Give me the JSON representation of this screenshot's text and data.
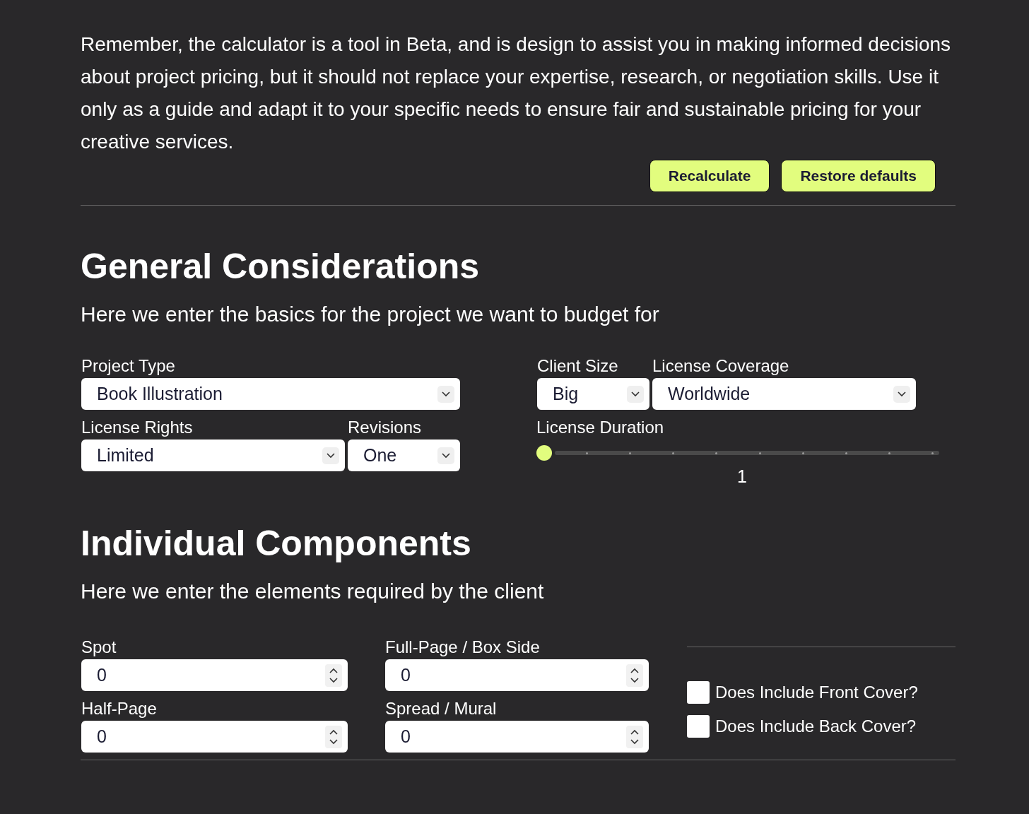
{
  "intro": {
    "text": "Remember, the calculator is a tool in Beta, and is design to assist you in making informed decisions about project pricing, but it should not replace your expertise, research, or negotiation skills. Use it only as a guide and adapt it to your specific needs to ensure fair and sustainable pricing for your creative services.",
    "buttons": [
      "Recalculate",
      "Restore defaults"
    ]
  },
  "general": {
    "title": "General Considerations",
    "subtitle": "Here we enter the basics for the project we want to budget for",
    "fields": [
      {
        "kind": "select",
        "label": "Project Type",
        "value": "Book Illustration"
      },
      {
        "kind": "select",
        "label": "Client Size",
        "value": "Big"
      },
      {
        "kind": "select",
        "label": "License Coverage",
        "value": "Worldwide"
      },
      {
        "kind": "select",
        "label": "License Rights",
        "value": "Limited"
      },
      {
        "kind": "select",
        "label": "Revisions",
        "value": "One"
      },
      {
        "kind": "slider",
        "label": "License Duration",
        "level": 0,
        "reading": "1"
      }
    ]
  },
  "components": {
    "title": "Individual Components",
    "subtitle": "Here we enter the elements required by the client",
    "fields": [
      {
        "kind": "number",
        "label": "Spot",
        "value": "0"
      },
      {
        "kind": "number",
        "label": "Full-Page / Box Side",
        "value": "0"
      },
      {
        "kind": "number",
        "label": "Half-Page",
        "value": "0"
      },
      {
        "kind": "number",
        "label": "Spread / Mural",
        "value": "0"
      }
    ],
    "checks": [
      {
        "label": "Does Include Front Cover?",
        "checked": false
      },
      {
        "label": "Does Include Back Cover?",
        "checked": false
      }
    ]
  }
}
